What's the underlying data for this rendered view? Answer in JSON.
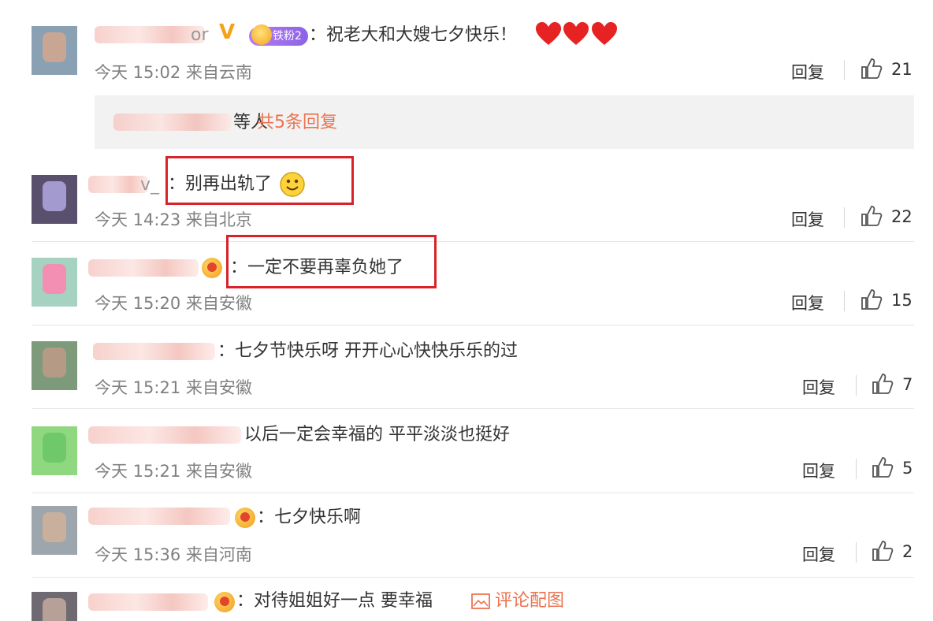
{
  "comments": [
    {
      "name_visible": "or",
      "text": "：祝老大和大嫂七夕快乐！",
      "fan_badge": "铁粉2",
      "time": "今天 15:02",
      "location": "来自云南",
      "reply": "回复",
      "likes": "21",
      "sub_replies": {
        "suffix": "等人",
        "count_text": "共5条回复"
      }
    },
    {
      "name_visible": "v_",
      "text": "：别再出轨了",
      "time": "今天 14:23",
      "location": "来自北京",
      "reply": "回复",
      "likes": "22"
    },
    {
      "text": "：一定不要再辜负她了",
      "time": "今天 15:20",
      "location": "来自安徽",
      "reply": "回复",
      "likes": "15"
    },
    {
      "text": "：七夕节快乐呀 开开心心快快乐乐的过",
      "time": "今天 15:21",
      "location": "来自安徽",
      "reply": "回复",
      "likes": "7"
    },
    {
      "text": "以后一定会幸福的 平平淡淡也挺好",
      "time": "今天 15:21",
      "location": "来自安徽",
      "reply": "回复",
      "likes": "5"
    },
    {
      "text": "：七夕快乐啊",
      "time": "今天 15:36",
      "location": "来自河南",
      "reply": "回复",
      "likes": "2"
    },
    {
      "text": "：对待姐姐好一点 要幸福",
      "pic_link": "评论配图"
    }
  ],
  "colors": {
    "accent": "#eb7350",
    "highlight_box": "#d8232a",
    "meta": "#808080"
  },
  "icons": [
    "verified-v-icon",
    "fan-badge-icon",
    "heart-emoji-icon",
    "smile-emoji-icon",
    "medal-icon",
    "thumbs-up-icon",
    "picture-icon"
  ]
}
